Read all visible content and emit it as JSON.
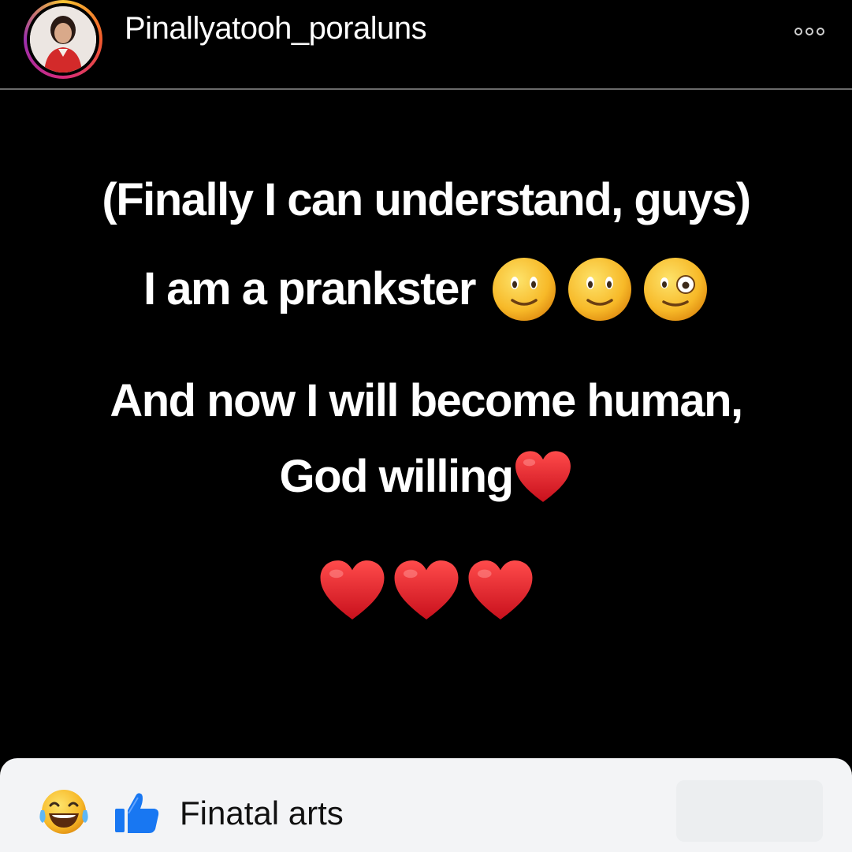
{
  "header": {
    "username": "Pinallyatooh_poraluns",
    "avatar_icon": "profile-photo",
    "more_icon": "ellipsis-icon"
  },
  "post": {
    "line1": "(Finally I can understand, guys)",
    "line2": "I am a prankster",
    "line2_emojis": [
      "slightly-smiling-face",
      "slightly-smiling-face",
      "zany-face"
    ],
    "line3": "And now I will become human,",
    "line4": "God willing",
    "line4_emoji": "red-heart",
    "hearts": [
      "red-heart",
      "red-heart",
      "red-heart"
    ]
  },
  "footer": {
    "reaction_icons": [
      "laughing-tears-icon",
      "thumbs-up-icon"
    ],
    "text": "Finatal arts"
  },
  "colors": {
    "background": "#000000",
    "text": "#ffffff",
    "heart": "#e21b25",
    "emoji_face": "#f7b928",
    "like_blue": "#1877f2",
    "footer_bg": "#f3f4f6"
  }
}
